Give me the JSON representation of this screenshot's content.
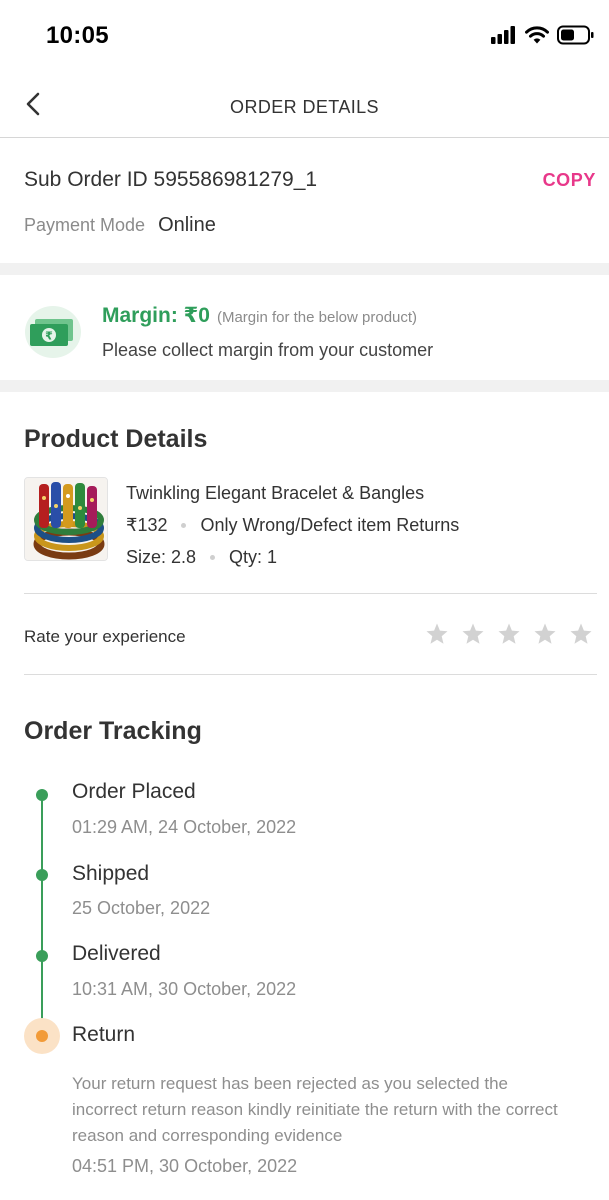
{
  "status_bar": {
    "time": "10:05"
  },
  "header": {
    "title": "ORDER DETAILS"
  },
  "suborder": {
    "id_text": "Sub Order ID 595586981279_1",
    "copy_label": "COPY",
    "payment_label": "Payment Mode",
    "payment_value": "Online"
  },
  "margin": {
    "title": "Margin: ₹0",
    "note": "(Margin for the below product)",
    "subtitle": "Please collect margin from your customer"
  },
  "product": {
    "section_title": "Product Details",
    "name": "Twinkling Elegant Bracelet & Bangles",
    "price": "₹132",
    "return_policy": "Only Wrong/Defect item Returns",
    "size": "Size: 2.8",
    "qty": "Qty: 1"
  },
  "rating": {
    "label": "Rate your experience",
    "stars_filled": 0,
    "stars_total": 5
  },
  "tracking": {
    "section_title": "Order Tracking",
    "steps": [
      {
        "title": "Order Placed",
        "time": "01:29 AM, 24 October, 2022"
      },
      {
        "title": "Shipped",
        "time": "25 October, 2022"
      },
      {
        "title": "Delivered",
        "time": "10:31 AM, 30 October, 2022"
      },
      {
        "title": "Return",
        "message": "Your return request has been rejected as you selected the incorrect return reason kindly reinitiate the return with the correct reason and corresponding evidence",
        "time": "04:51 PM, 30 October, 2022"
      }
    ]
  },
  "colors": {
    "accent_pink": "#e8388a",
    "margin_green": "#2f9e5b",
    "track_green": "#3a9e5a",
    "return_orange": "#f29b38"
  },
  "icons": [
    "back-arrow-icon",
    "signal-icon",
    "wifi-icon",
    "battery-icon",
    "money-icon",
    "star-icon"
  ]
}
